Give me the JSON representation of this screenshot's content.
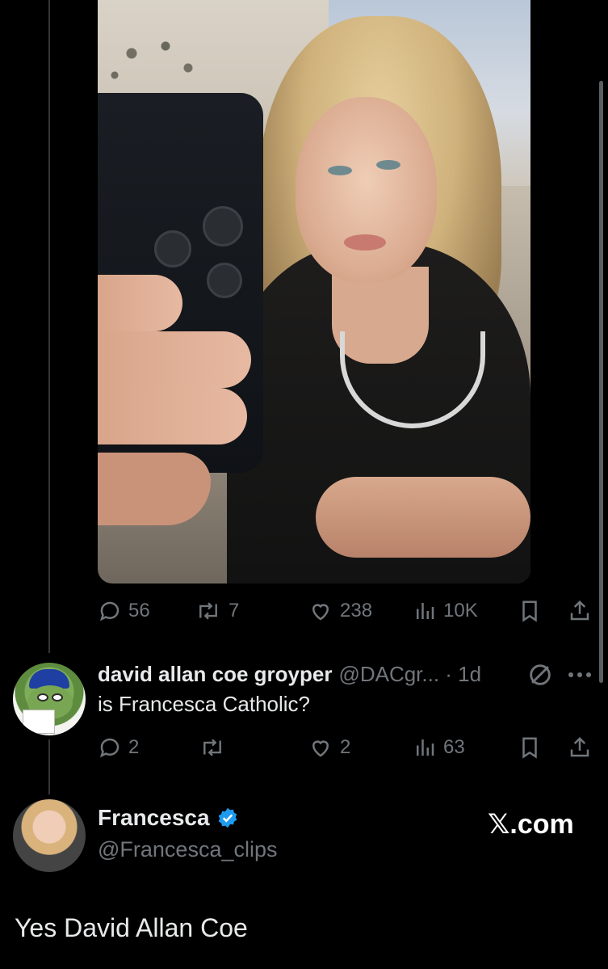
{
  "post": {
    "image_alt": "selfie photo",
    "stats": {
      "replies": "56",
      "reposts": "7",
      "likes": "238",
      "views": "10K"
    }
  },
  "reply": {
    "display_name": "david allan coe groyper",
    "handle_time": "@DACgr... · 1d",
    "text": "is Francesca Catholic?",
    "stats": {
      "replies": "2",
      "reposts": "",
      "likes": "2",
      "views": "63"
    }
  },
  "author": {
    "display_name": "Francesca",
    "handle": "@Francesca_clips",
    "watermark": "𝕏.com",
    "text": "Yes David Allan Coe"
  },
  "colors": {
    "background": "#000000",
    "text_primary": "#e7e9ea",
    "text_secondary": "#71767b",
    "verified": "#1d9bf0"
  },
  "icons": [
    "reply-icon",
    "repost-icon",
    "like-icon",
    "views-icon",
    "bookmark-icon",
    "share-icon",
    "mute-icon",
    "more-icon",
    "verified-icon"
  ]
}
